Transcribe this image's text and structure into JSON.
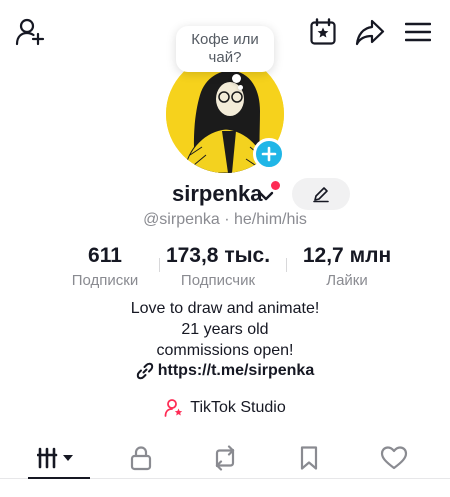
{
  "note": {
    "line1": "Кофе или",
    "line2": "чай?"
  },
  "profile": {
    "username": "sirpenka",
    "handle_line": "@sirpenka · he/him/his"
  },
  "stats": [
    {
      "value": "611",
      "label": "Подписки"
    },
    {
      "value": "173,8 тыс.",
      "label": "Подписчик"
    },
    {
      "value": "12,7 млн",
      "label": "Лайки"
    }
  ],
  "bio": {
    "lines": [
      "Love to draw and animate!",
      "21 years old",
      "commissions open!"
    ],
    "link": "https://t.me/sirpenka"
  },
  "studio": {
    "label": "TikTok Studio"
  },
  "colors": {
    "accent": "#fe2c55",
    "plus_badge": "#20b6e7",
    "avatar_bg": "#f6d21c"
  },
  "icons": {
    "top_bar": [
      "add-friend-icon",
      "calendar-star-icon",
      "share-icon",
      "menu-icon"
    ],
    "tabs": [
      "videos-grid-icon",
      "lock-icon",
      "repost-icon",
      "bookmark-icon",
      "heart-icon"
    ]
  }
}
